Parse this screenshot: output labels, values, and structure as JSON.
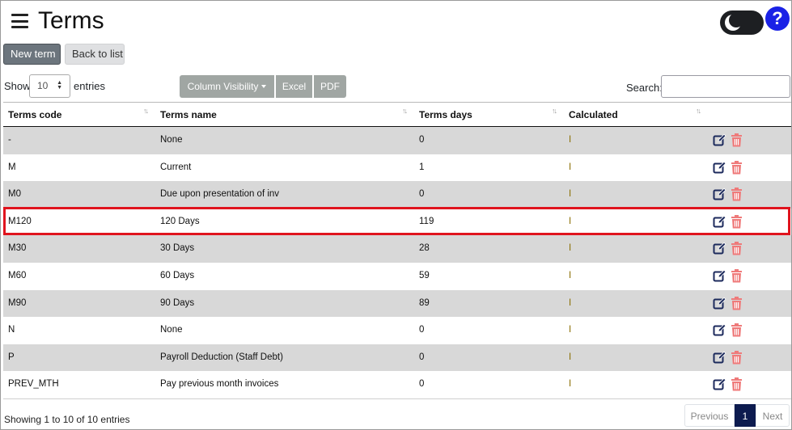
{
  "header": {
    "title": "Terms",
    "help_label": "?"
  },
  "toolbar": {
    "new_term_label": "New term",
    "back_to_list_label": "Back to list"
  },
  "length_control": {
    "show_label": "Show",
    "value": "10",
    "entries_label": "entries"
  },
  "export_buttons": {
    "column_visibility_label": "Column Visibility",
    "excel_label": "Excel",
    "pdf_label": "PDF"
  },
  "search": {
    "label": "Search:",
    "value": "",
    "placeholder": ""
  },
  "table": {
    "columns": [
      "Terms code",
      "Terms name",
      "Terms days",
      "Calculated"
    ],
    "sort_indicator": "↑↓",
    "rows": [
      {
        "code": "-",
        "name": "None",
        "days": "0",
        "calculated": "I"
      },
      {
        "code": "M",
        "name": "Current",
        "days": "1",
        "calculated": "I"
      },
      {
        "code": "M0",
        "name": "Due upon presentation of inv",
        "days": "0",
        "calculated": "I"
      },
      {
        "code": "M120",
        "name": "120 Days",
        "days": "119",
        "calculated": "I"
      },
      {
        "code": "M30",
        "name": "30 Days",
        "days": "28",
        "calculated": "I"
      },
      {
        "code": "M60",
        "name": "60 Days",
        "days": "59",
        "calculated": "I"
      },
      {
        "code": "M90",
        "name": "90 Days",
        "days": "89",
        "calculated": "I"
      },
      {
        "code": "N",
        "name": "None",
        "days": "0",
        "calculated": "I"
      },
      {
        "code": "P",
        "name": "Payroll Deduction (Staff Debt)",
        "days": "0",
        "calculated": "I"
      },
      {
        "code": "PREV_MTH",
        "name": "Pay previous month invoices",
        "days": "0",
        "calculated": "I"
      }
    ],
    "highlighted_row_code": "M120",
    "icons": {
      "edit": "edit-icon",
      "delete": "trash-icon"
    }
  },
  "footer": {
    "info": "Showing 1 to 10 of 10 entries",
    "previous_label": "Previous",
    "current_page": "1",
    "next_label": "Next"
  },
  "colors": {
    "primary_dark": "#0d1b4f",
    "edit_icon": "#1c2a5c",
    "delete_icon": "#ef7a7a",
    "highlight": "#e0141e",
    "help_blue": "#1a22e6",
    "striped_row": "#d8d8d8"
  }
}
